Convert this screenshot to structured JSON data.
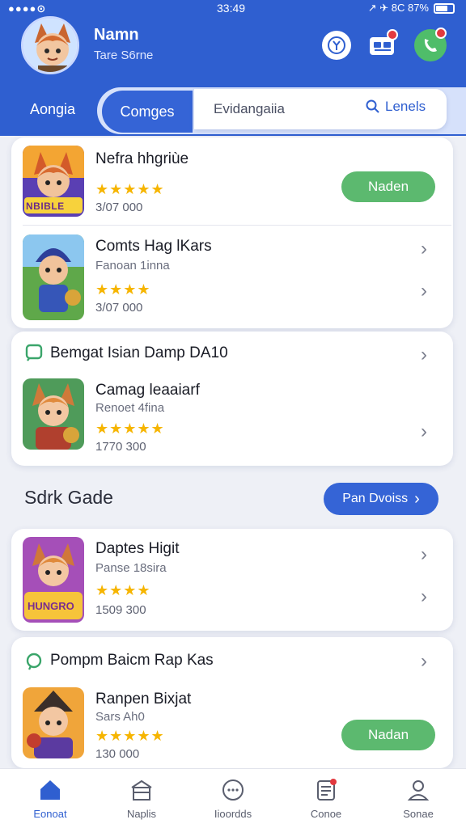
{
  "status_bar": {
    "signal": "●●●●⊙",
    "time": "33:49",
    "right": "↗ ✈ 8C 87%"
  },
  "profile": {
    "name": "Namn",
    "subtitle": "Tare S6rne"
  },
  "tabs": {
    "left_label": "Aongia",
    "active_label": "Comges"
  },
  "search": {
    "text": "Evidangaiia",
    "button_label": "Lenels"
  },
  "featured": {
    "game1": {
      "title": "Nefra hhgriùe",
      "stars": "★★★★★",
      "count": "3/07 000",
      "action_label": "Naden",
      "banner_text": "NBIBLE"
    },
    "game2": {
      "title": "Comts Hag lKars",
      "subtitle": "Fanoan 1inna",
      "stars": "★★★★",
      "count": "3/07 000"
    }
  },
  "group": {
    "title": "Bemgat Isian Damp DA10",
    "game": {
      "title": "Camag leaaiarf",
      "subtitle": "Renoet 4fina",
      "stars": "★★★★★",
      "count": "1770 300"
    }
  },
  "section": {
    "heading": "Sdrk Gade",
    "more_label": "Pan Dvoiss"
  },
  "list": {
    "game": {
      "title": "Daptes Higit",
      "subtitle": "Panse 18sira",
      "stars": "★★★★",
      "count": "1509 300",
      "banner_text": "HUNGRO"
    }
  },
  "group2": {
    "title": "Pompm Baicm Rap Kas",
    "game": {
      "title": "Ranpen Bixjat",
      "subtitle": "Sars Ah0",
      "stars": "★★★★★",
      "count": "130 000",
      "action_label": "Nadan"
    }
  },
  "bottom_nav": [
    {
      "label": "Eonoat",
      "icon": "home-icon"
    },
    {
      "label": "Naplis",
      "icon": "store-icon"
    },
    {
      "label": "Iioordds",
      "icon": "chat-icon"
    },
    {
      "label": "Conoe",
      "icon": "notes-icon"
    },
    {
      "label": "Sonae",
      "icon": "profile-icon"
    }
  ],
  "colors": {
    "primary": "#2f5fd0",
    "green": "#5cb96f",
    "star": "#f6b500",
    "badge": "#e2393f"
  }
}
